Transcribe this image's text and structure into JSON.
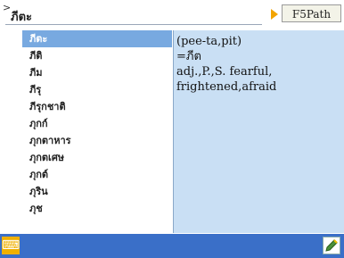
{
  "search": {
    "value": "ภีตะ"
  },
  "toolbar": {
    "dict_label": "F5Path"
  },
  "word_list": [
    {
      "label": "ภีตะ",
      "selected": true
    },
    {
      "label": "ภีติ"
    },
    {
      "label": "ภีม"
    },
    {
      "label": "ภีรุ"
    },
    {
      "label": "ภีรุกชาติ"
    },
    {
      "label": "ภุกก์"
    },
    {
      "label": "ภุกตาหาร"
    },
    {
      "label": "ภุกตเศษ"
    },
    {
      "label": "ภุกต์"
    },
    {
      "label": "ภุริน"
    },
    {
      "label": "ภุช"
    }
  ],
  "definition": {
    "lines": [
      "(pee-ta,pit)",
      "=ภีต",
      "adj.,P.,S. fearful,",
      "frightened,afraid"
    ]
  },
  "bottom": {
    "left_icon": "keyboard-icon",
    "right_icon": "edit-icon"
  },
  "colors": {
    "selection": "#78a9e0",
    "definition_bg": "#c9dff4",
    "bottom_bar": "#3a6fc8",
    "accent": "#f2a400"
  }
}
